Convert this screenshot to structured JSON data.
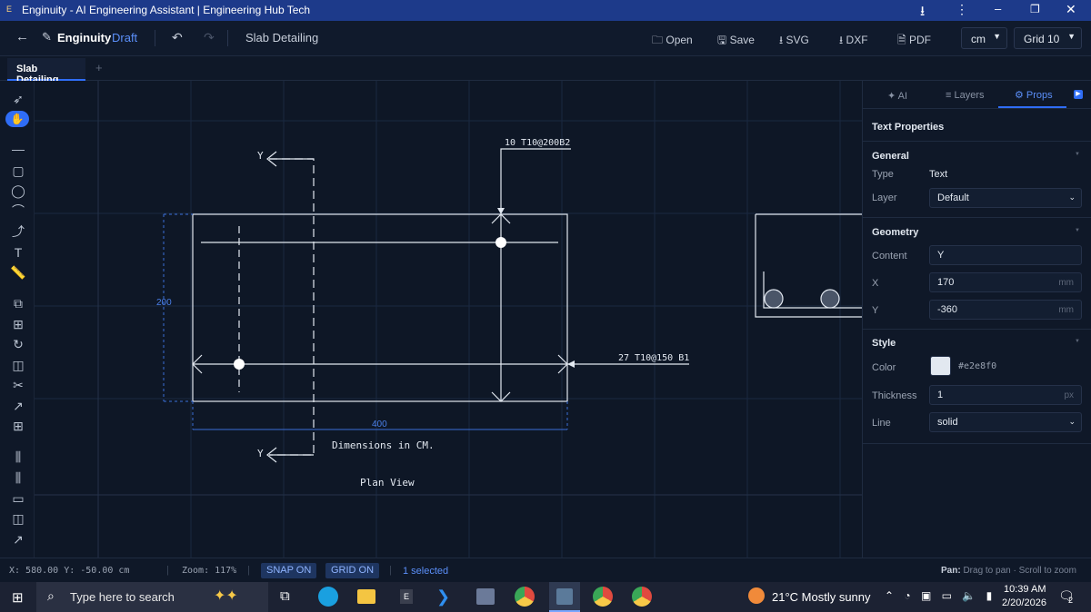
{
  "window": {
    "title": "Enginuity - AI Engineering Assistant | Engineering Hub Tech"
  },
  "toolbar": {
    "app_name": "Enginuity",
    "draft": "Draft",
    "doc_title": "Slab Detailing",
    "open": "Open",
    "save": "Save",
    "svg": "SVG",
    "dxf": "DXF",
    "pdf": "PDF",
    "unit": "cm",
    "grid": "Grid 10"
  },
  "tabs": {
    "active": "Slab Detailing",
    "add": "+"
  },
  "drawing": {
    "rebar_top": "10 T10@200B2",
    "rebar_bottom": "27 T10@150 B1",
    "section_label": "Y",
    "dim_height": "200",
    "dim_width": "400",
    "note1": "Dimensions in CM.",
    "note2": "Plan View"
  },
  "panel": {
    "tabs": {
      "ai": "✦ AI",
      "layers": "≡ Layers",
      "props": "⚙ Props"
    },
    "header": "Text Properties",
    "general": {
      "title": "General",
      "type_label": "Type",
      "type_value": "Text",
      "layer_label": "Layer",
      "layer_value": "Default"
    },
    "geometry": {
      "title": "Geometry",
      "content_label": "Content",
      "content_value": "Y",
      "x_label": "X",
      "x_value": "170",
      "y_label": "Y",
      "y_value": "-360",
      "unit": "mm"
    },
    "style": {
      "title": "Style",
      "color_label": "Color",
      "color_value": "#e2e8f0",
      "thickness_label": "Thickness",
      "thickness_value": "1",
      "thickness_unit": "px",
      "line_label": "Line",
      "line_value": "solid"
    }
  },
  "status": {
    "coords": "X: 580.00 Y: -50.00 cm",
    "zoom": "Zoom: 117%",
    "snap": "SNAP ON",
    "grid": "GRID ON",
    "selected": "1 selected",
    "pan_bold": "Pan:",
    "pan_hint": "Drag to pan · Scroll to zoom"
  },
  "taskbar": {
    "search": "Type here to search",
    "weather": "21°C  Mostly sunny",
    "time": "10:39 AM",
    "date": "2/20/2026",
    "notif": "2"
  }
}
